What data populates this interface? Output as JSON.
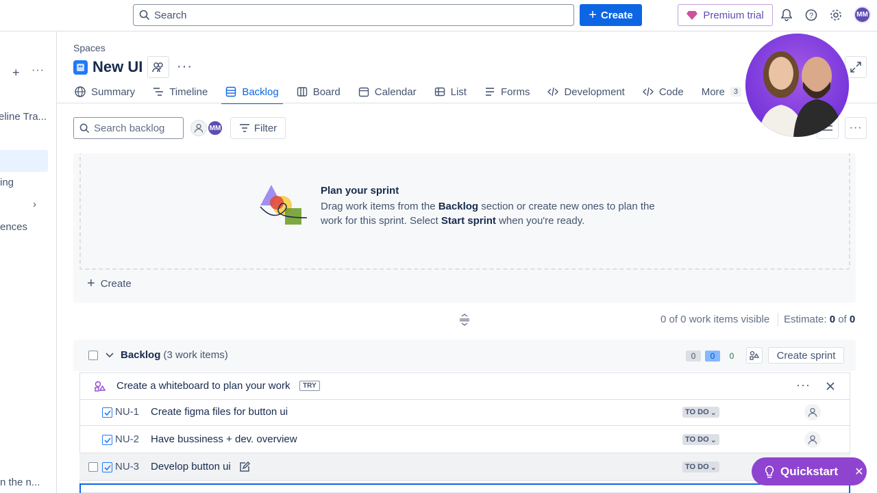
{
  "topbar": {
    "search_placeholder": "Search",
    "create_label": "Create",
    "premium_label": "Premium trial",
    "avatar_initials": "MM"
  },
  "sidebar": {
    "items": [
      "eline Tra...",
      "ing",
      "ences",
      "n the n..."
    ]
  },
  "breadcrumb": "Spaces",
  "project": {
    "title": "New UI"
  },
  "tabs": [
    {
      "label": "Summary",
      "icon": "globe-icon"
    },
    {
      "label": "Timeline",
      "icon": "timeline-icon"
    },
    {
      "label": "Backlog",
      "icon": "backlog-icon",
      "active": true
    },
    {
      "label": "Board",
      "icon": "board-icon"
    },
    {
      "label": "Calendar",
      "icon": "calendar-icon"
    },
    {
      "label": "List",
      "icon": "list-icon"
    },
    {
      "label": "Forms",
      "icon": "forms-icon"
    },
    {
      "label": "Development",
      "icon": "code-icon"
    },
    {
      "label": "Code",
      "icon": "code-icon"
    },
    {
      "label": "More",
      "count": "3"
    }
  ],
  "toolbar": {
    "search_placeholder": "Search backlog",
    "avatar_initials": "MM",
    "filter_label": "Filter"
  },
  "sprint": {
    "plan_title": "Plan your sprint",
    "plan_text_1": "Drag work items from the ",
    "plan_bold_1": "Backlog",
    "plan_text_2": " section or create new ones to plan the work for this sprint. Select ",
    "plan_bold_2": "Start sprint",
    "plan_text_3": " when you're ready.",
    "create_label": "Create",
    "visible_text": "0 of 0 work items visible",
    "estimate_label": "Estimate: ",
    "estimate_value": "0",
    "estimate_of": " of ",
    "estimate_total": "0"
  },
  "backlog": {
    "title": "Backlog",
    "count_text": " (3 work items)",
    "counts": [
      "0",
      "0",
      "0"
    ],
    "create_sprint_label": "Create sprint",
    "whiteboard_text": "Create a whiteboard to plan your work",
    "try_label": "TRY",
    "items": [
      {
        "key": "NU-1",
        "summary": "Create figma files for button ui",
        "status": "TO DO"
      },
      {
        "key": "NU-2",
        "summary": "Have bussiness + dev. overview",
        "status": "TO DO"
      },
      {
        "key": "NU-3",
        "summary": "Develop button ui",
        "status": "TO DO"
      }
    ]
  },
  "quickstart": {
    "label": "Quickstart"
  },
  "colors": {
    "accent": "#0c66e4",
    "quickstart": "#8f44d0",
    "premium": "#5e4db2"
  }
}
